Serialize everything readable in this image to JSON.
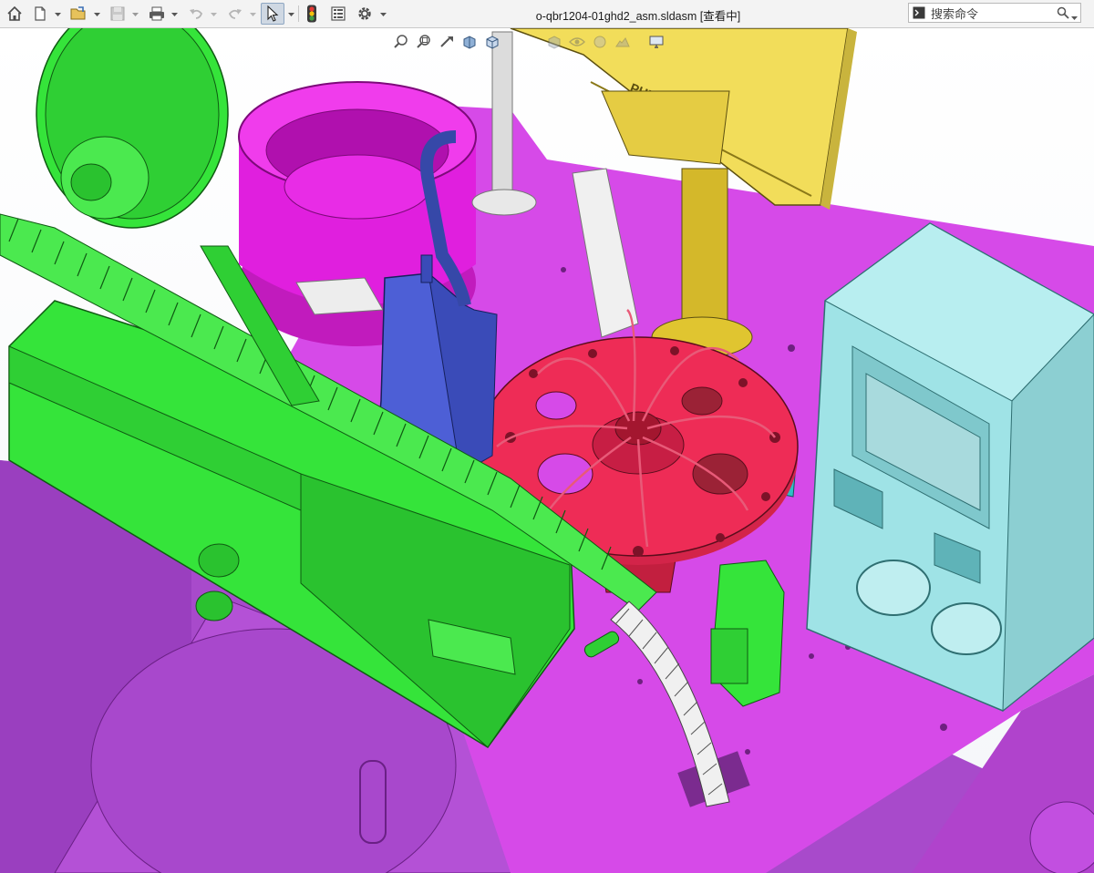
{
  "window": {
    "title": "o-qbr1204-01ghd2_asm.sldasm [查看中]"
  },
  "toolbar": {
    "items": [
      {
        "name": "home",
        "icon": "home-icon"
      },
      {
        "name": "new",
        "icon": "new-document-icon"
      },
      {
        "name": "open",
        "icon": "open-folder-icon"
      },
      {
        "name": "save",
        "icon": "save-icon",
        "enabled": false
      },
      {
        "name": "print",
        "icon": "print-icon"
      },
      {
        "name": "undo",
        "icon": "undo-icon",
        "enabled": false
      },
      {
        "name": "redo",
        "icon": "redo-icon",
        "enabled": false
      },
      {
        "name": "select",
        "icon": "cursor-arrow-icon",
        "active": true
      },
      {
        "name": "rebuild",
        "icon": "traffic-light-icon"
      },
      {
        "name": "file-properties",
        "icon": "file-properties-icon"
      },
      {
        "name": "options",
        "icon": "gear-icon"
      }
    ]
  },
  "search": {
    "placeholder": "搜索命令",
    "icon": "magnifier-icon",
    "command_icon": "command-prompt-icon"
  },
  "heads_up_toolbar": {
    "items": [
      {
        "name": "zoom-to-fit",
        "icon": "zoom-to-fit-icon"
      },
      {
        "name": "zoom-to-area",
        "icon": "zoom-to-area-icon"
      },
      {
        "name": "previous-view",
        "icon": "previous-view-icon"
      },
      {
        "name": "section-view",
        "icon": "section-view-icon"
      },
      {
        "name": "view-orientation",
        "icon": "view-orientation-cube-icon"
      },
      {
        "name": "display-style",
        "icon": "display-style-icon"
      },
      {
        "name": "hide-show-items",
        "icon": "hide-show-eye-icon"
      },
      {
        "name": "edit-appearance",
        "icon": "appearance-sphere-icon"
      },
      {
        "name": "apply-scene",
        "icon": "scene-icon"
      },
      {
        "name": "view-settings",
        "icon": "monitor-icon"
      }
    ]
  },
  "model": {
    "monitor_brand": "PHILIPS",
    "parts_colors": {
      "base_cabinet": "#b44fd8",
      "top_plate": "#d444e6",
      "feed_module": "#35e43a",
      "vibratory_bowl": "#e21ee0",
      "rotary_table": "#ee2c56",
      "control_box": "#9fe3e6",
      "pneumatic_slide": "#4d5fd6",
      "monitor": "#f2dd5a",
      "monitor_post": "#d4b82a",
      "teal_bracket": "#2fc0c6",
      "white_parts": "#ececec"
    }
  }
}
